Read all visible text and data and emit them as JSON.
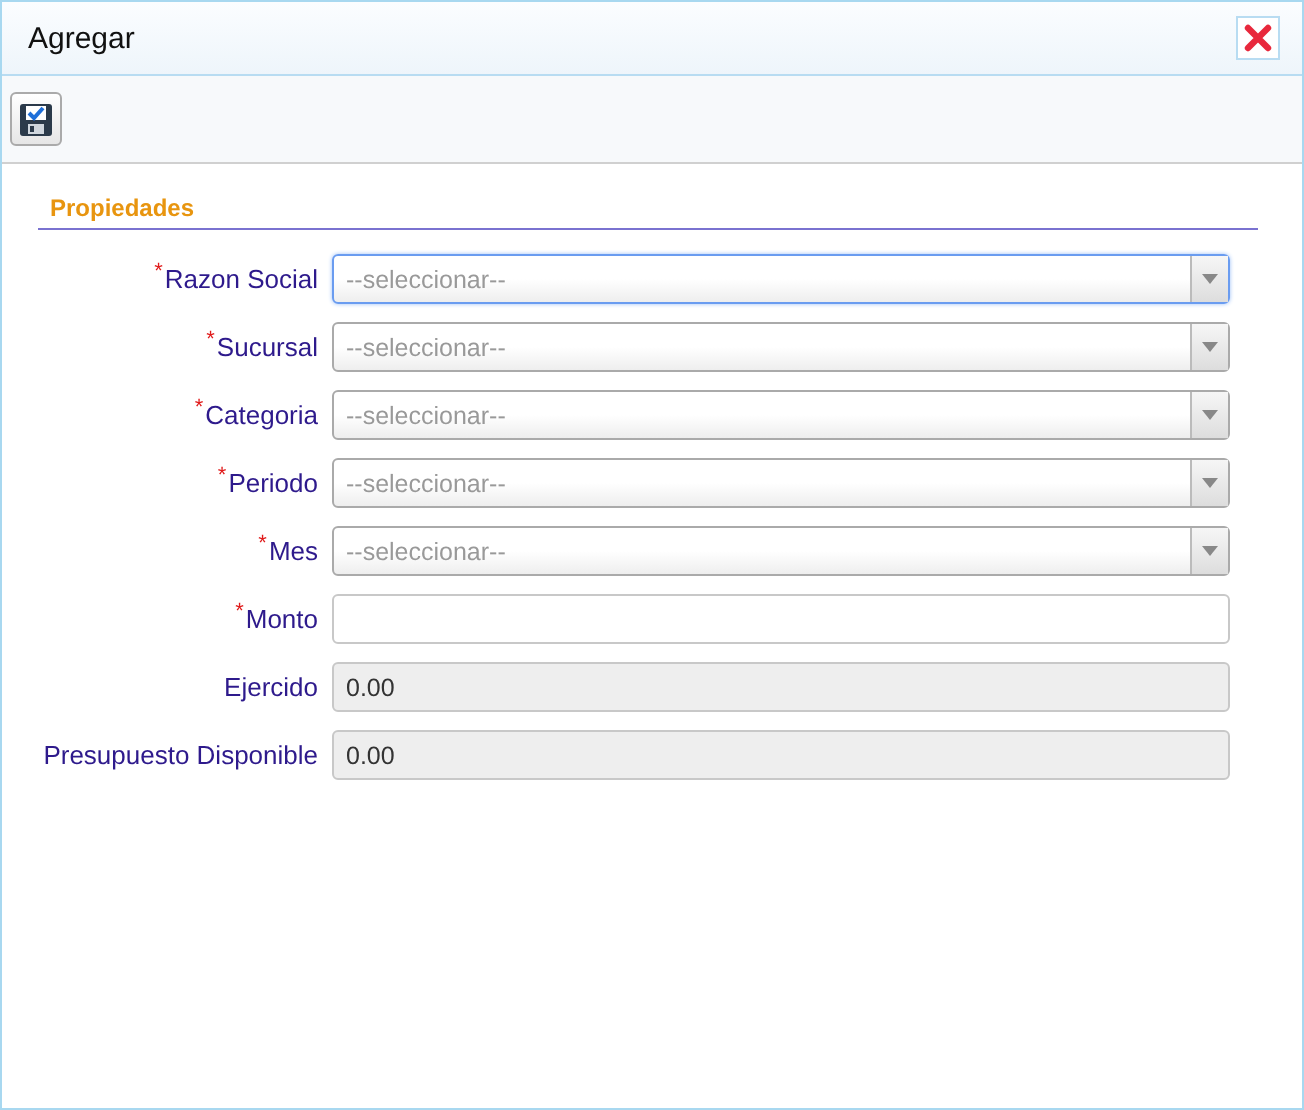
{
  "window": {
    "title": "Agregar"
  },
  "section": {
    "title": "Propiedades"
  },
  "fields": [
    {
      "kind": "select",
      "label": "Razon Social",
      "required_mark": "*",
      "focused": true,
      "placeholder": "--seleccionar--"
    },
    {
      "kind": "select",
      "label": "Sucursal",
      "required_mark": "*",
      "focused": false,
      "placeholder": "--seleccionar--"
    },
    {
      "kind": "select",
      "label": "Categoria",
      "required_mark": "*",
      "focused": false,
      "placeholder": "--seleccionar--"
    },
    {
      "kind": "select",
      "label": "Periodo",
      "required_mark": "*",
      "focused": false,
      "placeholder": "--seleccionar--"
    },
    {
      "kind": "select",
      "label": "Mes",
      "required_mark": "*",
      "focused": false,
      "placeholder": "--seleccionar--"
    },
    {
      "kind": "text",
      "label": "Monto",
      "required_mark": "*",
      "focused": false
    },
    {
      "kind": "readonly",
      "label": "Ejercido",
      "value": "0.00"
    },
    {
      "kind": "readonly",
      "label": "Presupuesto Disponible",
      "value": "0.00"
    }
  ]
}
